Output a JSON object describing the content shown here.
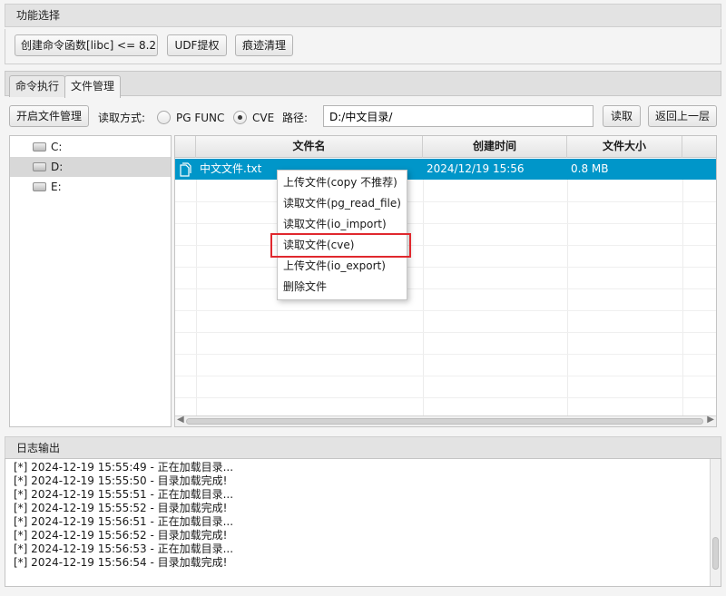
{
  "func_panel": {
    "title": "功能选择",
    "buttons": [
      "创建命令函数[libc] <= 8.2",
      "UDF提权",
      "痕迹清理"
    ]
  },
  "tabs": [
    "命令执行",
    "文件管理"
  ],
  "toolbar": {
    "open_fm_label": "开启文件管理",
    "read_mode_label": "读取方式:",
    "radio_pg_func": "PG FUNC",
    "radio_cve": "CVE",
    "selected_mode": "CVE",
    "path_label": "路径:",
    "path_value": "D:/中文目录/",
    "read_button": "读取",
    "back_button": "返回上一层"
  },
  "drives": [
    {
      "name": "C:",
      "selected": false
    },
    {
      "name": "D:",
      "selected": true
    },
    {
      "name": "E:",
      "selected": false
    }
  ],
  "file_table": {
    "columns": [
      "文件名",
      "创建时间",
      "文件大小"
    ],
    "rows": [
      {
        "name": "中文文件.txt",
        "created": "2024/12/19 15:56",
        "size": "0.8 MB",
        "selected": true
      }
    ]
  },
  "context_menu": {
    "items": [
      "上传文件(copy 不推荐)",
      "读取文件(pg_read_file)",
      "读取文件(io_import)",
      "读取文件(cve)",
      "上传文件(io_export)",
      "删除文件"
    ],
    "highlighted_index": 3,
    "highlight_color": "#e0282e"
  },
  "log_panel": {
    "title": "日志输出",
    "lines": [
      "[*] 2024-12-19 15:55:49 - 正在加载目录...",
      "[*] 2024-12-19 15:55:50 - 目录加载完成!",
      "[*] 2024-12-19 15:55:51 - 正在加载目录...",
      "[*] 2024-12-19 15:55:52 - 目录加载完成!",
      "[*] 2024-12-19 15:56:51 - 正在加载目录...",
      "[*] 2024-12-19 15:56:52 - 目录加载完成!",
      "[*] 2024-12-19 15:56:53 - 正在加载目录...",
      "[*] 2024-12-19 15:56:54 - 目录加载完成!"
    ]
  },
  "colors": {
    "selection": "#0096c9",
    "panel_bg": "#f4f4f4"
  }
}
